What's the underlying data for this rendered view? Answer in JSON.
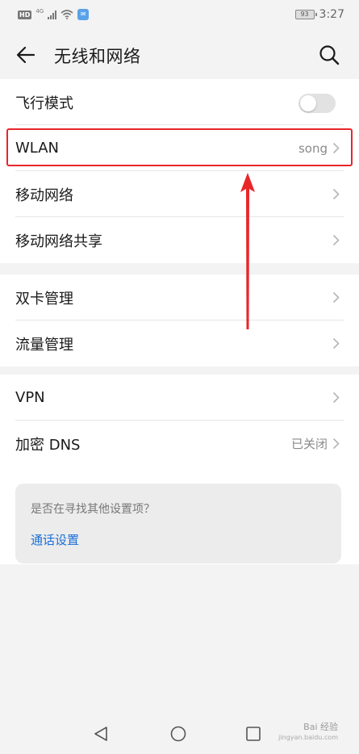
{
  "status_bar": {
    "hd": "HD",
    "network": "4G",
    "battery": "93",
    "time": "3:27"
  },
  "header": {
    "title": "无线和网络",
    "back_icon": "arrow-left-icon",
    "search_icon": "search-icon"
  },
  "groups": [
    {
      "items": [
        {
          "label": "飞行模式",
          "type": "toggle",
          "on": false
        },
        {
          "label": "WLAN",
          "value": "song",
          "type": "link",
          "highlighted": true
        },
        {
          "label": "移动网络",
          "type": "link"
        },
        {
          "label": "移动网络共享",
          "type": "link"
        }
      ]
    },
    {
      "items": [
        {
          "label": "双卡管理",
          "type": "link"
        },
        {
          "label": "流量管理",
          "type": "link"
        }
      ]
    },
    {
      "items": [
        {
          "label": "VPN",
          "type": "link"
        },
        {
          "label": "加密 DNS",
          "value": "已关闭",
          "type": "link"
        }
      ]
    }
  ],
  "suggestion": {
    "title": "是否在寻找其他设置项？",
    "link": "通话设置"
  },
  "annotation": {
    "color": "#e8262a"
  },
  "nav": {
    "back_icon": "triangle-back-icon",
    "home_icon": "circle-home-icon",
    "recents_icon": "square-recents-icon"
  },
  "watermark": {
    "brand": "Bai 经验",
    "domain": "jingyan.baidu.com"
  }
}
